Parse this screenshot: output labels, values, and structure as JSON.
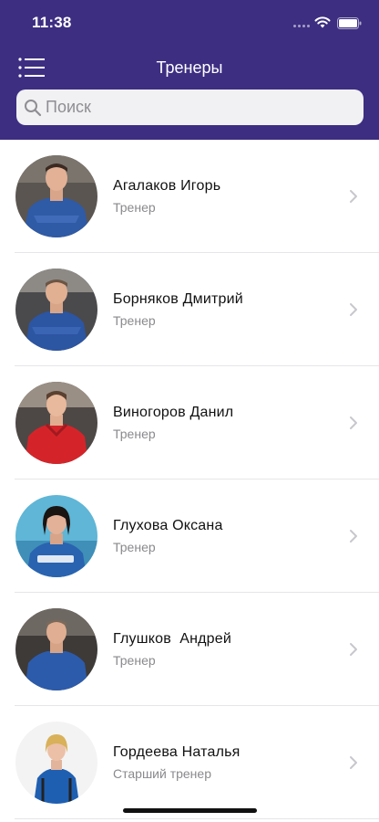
{
  "status_bar": {
    "time": "11:38"
  },
  "nav": {
    "title": "Тренеры",
    "menu_icon": "menu-list-icon"
  },
  "search": {
    "placeholder": "Поиск",
    "value": ""
  },
  "colors": {
    "header": "#3d2e82",
    "search_bg": "#f1f1f3",
    "secondary_text": "#8a8a8e"
  },
  "trainers": [
    {
      "name": "Агалаков Игорь",
      "role": "Тренер"
    },
    {
      "name": "Борняков Дмитрий",
      "role": "Тренер"
    },
    {
      "name": "Виногоров Данил",
      "role": "Тренер"
    },
    {
      "name": "Глухова Оксана",
      "role": "Тренер"
    },
    {
      "name": "Глушков  Андрей",
      "role": "Тренер"
    },
    {
      "name": "Гордеева Наталья",
      "role": "Старший тренер"
    }
  ]
}
